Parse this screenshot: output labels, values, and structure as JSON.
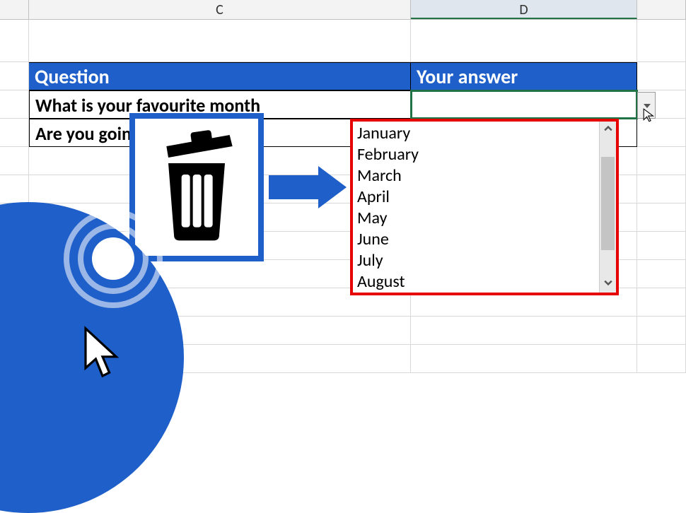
{
  "columns": {
    "c": "C",
    "d": "D"
  },
  "table": {
    "header_question": "Question",
    "header_answer": "Your answer",
    "row1_question": "What is your favourite month",
    "row1_answer": "",
    "row2_question_visible": "Are you goin                           s year"
  },
  "dropdown": {
    "items": [
      "January",
      "February",
      "March",
      "April",
      "May",
      "June",
      "July",
      "August"
    ]
  },
  "icons": {
    "trash": "trash-icon",
    "arrow": "arrow-right-icon",
    "dropdown": "chevron-down-icon",
    "scroll_up": "chevron-up-icon",
    "scroll_down": "chevron-down-icon",
    "cursor": "cursor-icon",
    "click_target": "click-target-icon"
  },
  "colors": {
    "header_blue": "#1f5fc9",
    "highlight_red": "#e60000",
    "selection_green": "#217346"
  }
}
